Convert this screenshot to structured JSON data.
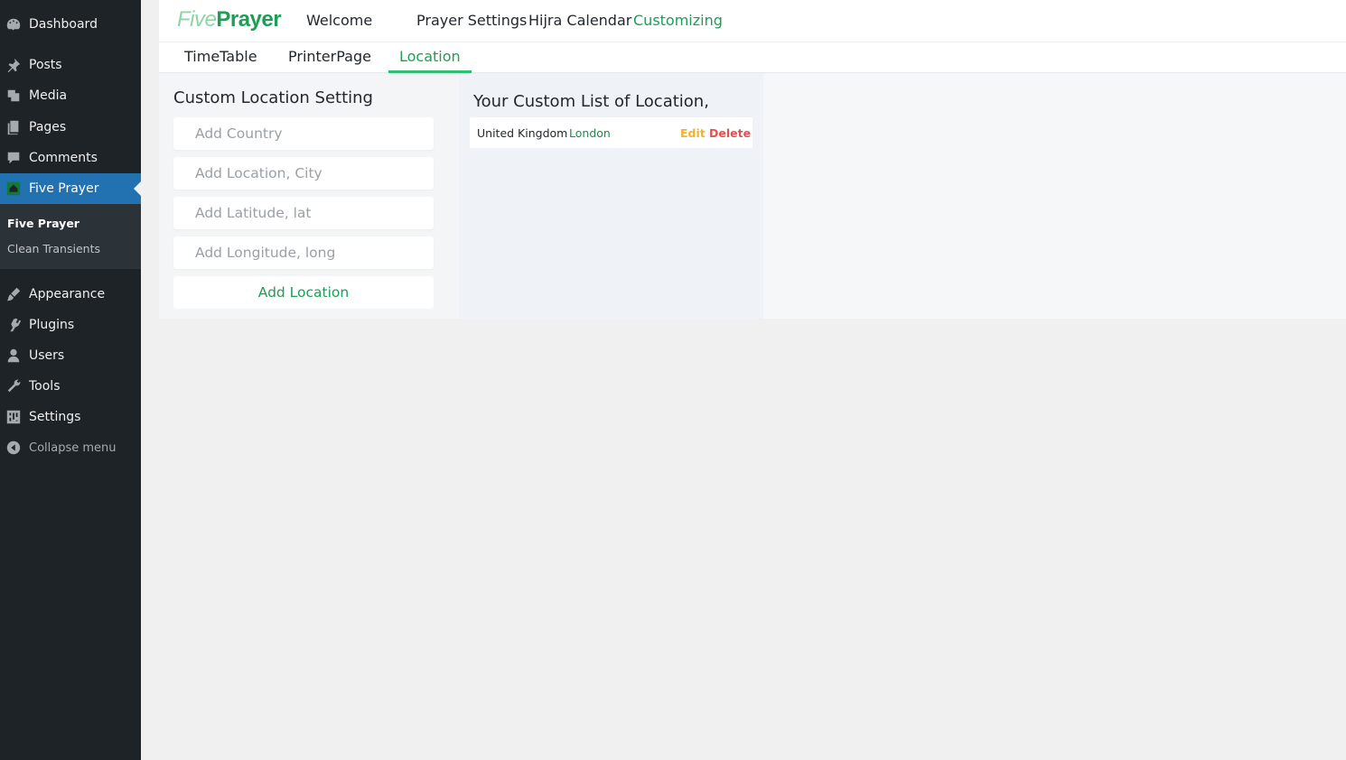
{
  "sidebar": {
    "items": [
      {
        "label": "Dashboard",
        "icon": "dashboard-icon"
      },
      {
        "label": "Posts",
        "icon": "pin-icon"
      },
      {
        "label": "Media",
        "icon": "media-icon"
      },
      {
        "label": "Pages",
        "icon": "pages-icon"
      },
      {
        "label": "Comments",
        "icon": "comment-icon"
      },
      {
        "label": "Five Prayer",
        "icon": "five-prayer-icon",
        "active": true
      },
      {
        "label": "Appearance",
        "icon": "brush-icon"
      },
      {
        "label": "Plugins",
        "icon": "plugin-icon"
      },
      {
        "label": "Users",
        "icon": "user-icon"
      },
      {
        "label": "Tools",
        "icon": "wrench-icon"
      },
      {
        "label": "Settings",
        "icon": "settings-icon"
      }
    ],
    "submenu": [
      {
        "label": "Five Prayer",
        "current": true
      },
      {
        "label": "Clean Transients"
      }
    ],
    "collapse_label": "Collapse menu"
  },
  "header": {
    "logo_five": "Five",
    "logo_prayer": "Prayer",
    "nav": [
      "Welcome",
      "Prayer Settings",
      "Hijra Calendar",
      "Customizing"
    ],
    "active_nav": "Customizing"
  },
  "tabs": {
    "items": [
      "TimeTable",
      "PrinterPage",
      "Location"
    ],
    "active": "Location"
  },
  "form": {
    "title": "Custom Location Setting",
    "country_placeholder": "Add Country",
    "city_placeholder": "Add Location, City",
    "lat_placeholder": "Add Latitude, lat",
    "long_placeholder": "Add Longitude, long",
    "submit_label": "Add Location"
  },
  "list": {
    "title": "Your Custom List of Location,",
    "rows": [
      {
        "country": "United Kingdom",
        "city": "London",
        "edit_label": "Edit",
        "delete_label": "Delete"
      }
    ]
  },
  "colors": {
    "accent": "#1f9d55",
    "admin_menu_bg": "#1d2327",
    "admin_active": "#2271b1",
    "edit": "#f0b429",
    "delete": "#e05252"
  }
}
